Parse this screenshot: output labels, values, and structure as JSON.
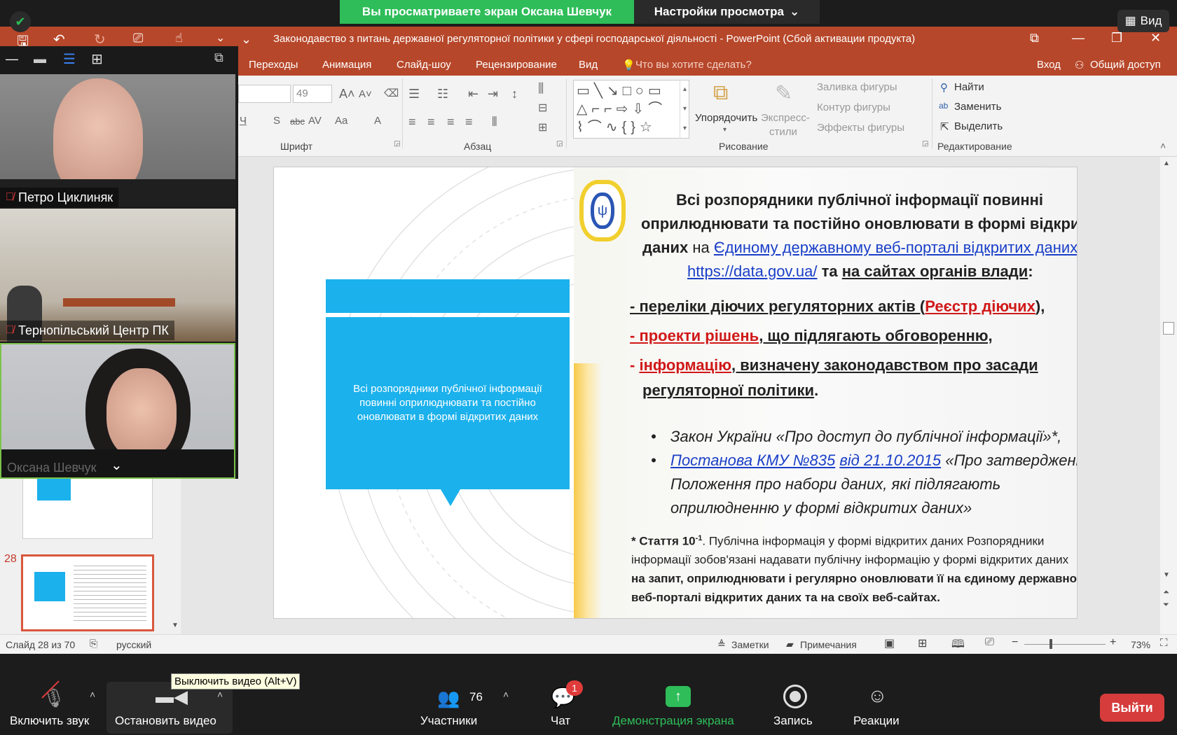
{
  "zoom": {
    "banner": "Вы просматриваете экран Оксана Шевчук",
    "view_options": "Настройки просмотра",
    "view_button": "Вид",
    "bottom": {
      "audio": "Включить звук",
      "video": "Остановить видео",
      "participants": "Участники",
      "participants_count": "76",
      "chat": "Чат",
      "chat_badge": "1",
      "share": "Демонстрация экрана",
      "record": "Запись",
      "reactions": "Реакции",
      "leave": "Выйти",
      "tooltip": "Выключить видео (Alt+V)"
    },
    "participants_tiles": [
      {
        "name": "Петро Циклиняк"
      },
      {
        "name": "Тернопільський Центр ПК"
      },
      {
        "name": "Оксана Шевчук"
      }
    ]
  },
  "ppt": {
    "title": "Законодавство з питань державної регуляторної політики у сфері господарської діяльності - PowerPoint (Сбой активации продукта)",
    "tabs": [
      "Переходы",
      "Анимация",
      "Слайд-шоу",
      "Рецензирование",
      "Вид"
    ],
    "tell_me": "Что вы хотите сделать?",
    "signin": "Вход",
    "share": "Общий доступ",
    "font_size": "49",
    "groups": {
      "font": "Шрифт",
      "paragraph": "Абзац",
      "drawing": "Рисование",
      "editing": "Редактирование"
    },
    "drawing": {
      "arrange": "Упорядочить",
      "quick_styles_1": "Экспресс-",
      "quick_styles_2": "стили",
      "fill": "Заливка фигуры",
      "outline": "Контур фигуры",
      "effects": "Эффекты фигуры"
    },
    "editing": {
      "find": "Найти",
      "replace": "Заменить",
      "select": "Выделить"
    },
    "thumb_number": "28",
    "status": {
      "slide": "Слайд 28 из 70",
      "lang": "русский",
      "notes": "Заметки",
      "comments": "Примечания",
      "zoom": "73%"
    },
    "slide": {
      "box_text": "Всі розпорядники публічної інформації повинні оприлюднювати та постійно оновлювати в формі відкритих даних",
      "h1": "Всі розпорядники публічної інформації повинні",
      "h2": "оприлюднювати та постійно оновлювати в формі відкритих",
      "h3a": "даних",
      "h3b": "на",
      "h3c": "Єдиному державному веб-порталі відкритих даних",
      "h4a": "https://data.gov.ua/",
      "h4b": "та",
      "h4c": "на сайтах органів влади",
      "h4d": ":",
      "b1a": "- переліки діючих регуляторних актів (",
      "b1b": "Реєстр діючих",
      "b1c": "),",
      "b2a": "- проекти рішень",
      "b2b": ", що підлягають обговоренню,",
      "b3a": "- ",
      "b3b": "інформацію",
      "b3c": ", визначену законодавством про засади",
      "b3d": "регуляторної політики",
      "b3e": ".",
      "l1": "Закон України «Про доступ до публічної інформації»*,",
      "l2a": "Постанова КМУ №835",
      "l2b": "від 21.10.2015",
      "l2c": "«Про затвердження",
      "l3": "Положення про набори даних, які підлягають",
      "l4": "оприлюдненню у формі відкритих даних»",
      "f1a": "* Стаття 10",
      "f1sup": "-1",
      "f1b": ". Публічна інформація у формі відкритих даних Розпорядники",
      "f2": "інформації зобов'язані надавати публічну інформацію у формі відкритих даних",
      "f3": "на запит, оприлюднювати і регулярно оновлювати її на єдиному державному",
      "f4": "веб-порталі відкритих даних та на своїх веб-сайтах."
    }
  },
  "colors": {
    "ppt": "#b7472a",
    "zoom_green": "#2ebd59",
    "slide_blue": "#1bb1ec",
    "leave": "#d63c3c"
  }
}
